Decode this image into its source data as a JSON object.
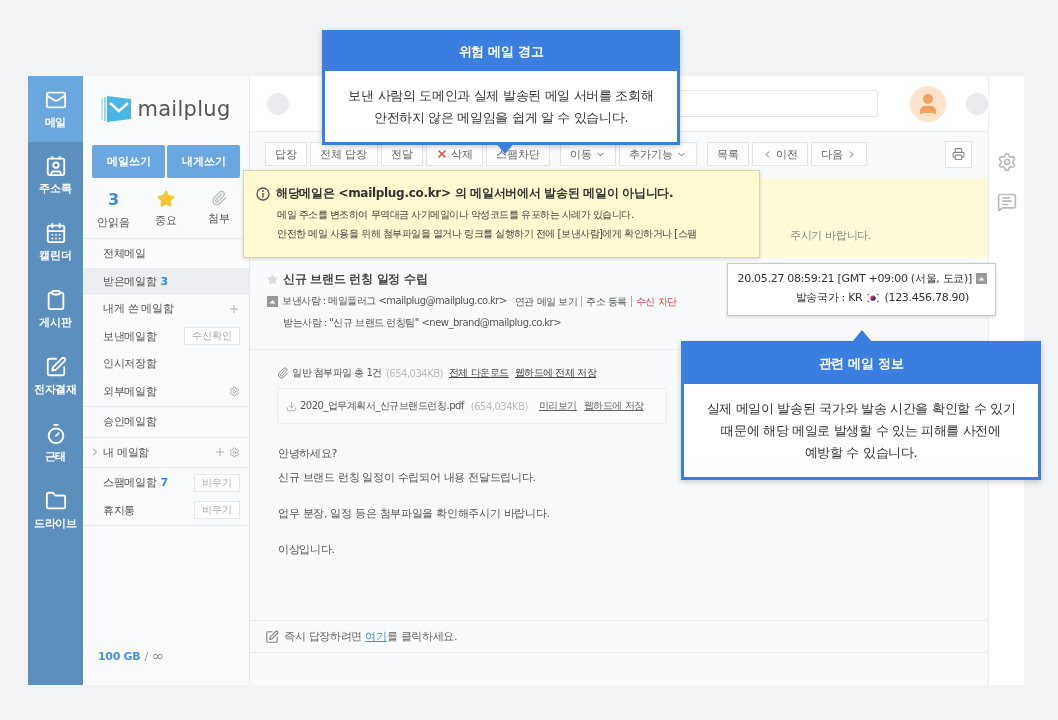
{
  "nav": [
    {
      "label": "메일",
      "selected": true
    },
    {
      "label": "주소록",
      "selected": false
    },
    {
      "label": "캘린더",
      "selected": false
    },
    {
      "label": "게시판",
      "selected": false
    },
    {
      "label": "전자결재",
      "selected": false
    },
    {
      "label": "근태",
      "selected": false
    },
    {
      "label": "드라이브",
      "selected": false
    }
  ],
  "logo": {
    "text": "mailplug"
  },
  "compose_buttons": [
    "메일쓰기",
    "내게쓰기"
  ],
  "quick_filters": [
    {
      "label": "안읽음",
      "count": "3"
    },
    {
      "label": "중요"
    },
    {
      "label": "첨부"
    }
  ],
  "folder_sections": [
    [
      {
        "label": "전체메일",
        "kind": "plain",
        "selected": false
      },
      {
        "label": "받은메일함",
        "count": "3",
        "kind": "plain",
        "selected": true
      },
      {
        "label": "내게 쓴 메일함",
        "kind": "add",
        "selected": false
      },
      {
        "label": "보낸메일함",
        "kind": "button",
        "action": "수신확인",
        "selected": false
      },
      {
        "label": "인시저장함",
        "kind": "plain",
        "selected": false
      },
      {
        "label": "외부메일함",
        "kind": "settings",
        "selected": false
      }
    ],
    [
      {
        "label": "승인메일함",
        "kind": "plain",
        "selected": false
      }
    ],
    [
      {
        "label": "내 메일함",
        "kind": "group",
        "selected": false
      }
    ],
    [
      {
        "label": "스팸메일함",
        "count": "7",
        "kind": "button",
        "action": "비우기",
        "selected": false
      },
      {
        "label": "휴지통",
        "kind": "button",
        "action": "비우기",
        "selected": false
      }
    ]
  ],
  "storage": {
    "used": "100 GB",
    "separator": "/",
    "limit": "∞"
  },
  "toolbar_groups": [
    [
      {
        "label": "답장",
        "kind": "plain"
      },
      {
        "label": "전체 답장",
        "kind": "plain"
      },
      {
        "label": "전달",
        "kind": "plain"
      },
      {
        "label": "삭제",
        "kind": "delete"
      },
      {
        "label": "스팸차단",
        "kind": "plain"
      }
    ],
    [
      {
        "label": "이동",
        "kind": "dropdown"
      },
      {
        "label": "추가기능",
        "kind": "dropdown"
      }
    ],
    [
      {
        "label": "목록",
        "kind": "plain"
      },
      {
        "label": "이전",
        "kind": "prev"
      },
      {
        "label": "다음",
        "kind": "next"
      }
    ]
  ],
  "warning_banner": {
    "text": "주시기 바랍니다."
  },
  "warning_popup": {
    "title": "해당메일은 <mailplug.co.kr> 의 메일서버에서 발송된 메일이 아닙니다.",
    "lines": [
      "메일 주소를 변조하여 무역대금 사기메일이나 악성코드를 유포하는 사례가 있습니다.",
      "안전한 메일 사용을 위해 첨부파일을 열거나 링크를 실행하기 전에 [보낸사람]에게 확인하거나 [스팸"
    ]
  },
  "message": {
    "subject": "신규 브랜드 런칭 일정 수립",
    "starred": false,
    "sender": "보낸사람 : 메일플러그 <mailplug@mailplug.co.kr>",
    "sender_links": [
      {
        "label": "연관 메일 보기",
        "kind": "normal"
      },
      {
        "label": "주소 등록",
        "kind": "normal"
      },
      {
        "label": "수신 차단",
        "kind": "danger"
      }
    ],
    "recipient": "받는사람 : \"신규 브랜드 런칭팀\" <new_brand@mailplug.co.kr>",
    "attachments": {
      "summary": "일반 첨부파일 총 1건",
      "size": "(654,034KB)",
      "actions": [
        "전체 다운로드",
        "웹하드에 전체 저장"
      ],
      "files": [
        {
          "name": "2020_업무계획서_신규브랜드런칭.pdf",
          "size": "(654,034KB)",
          "actions": [
            "미리보기",
            "웹하드에 저장"
          ]
        }
      ]
    },
    "body": [
      [
        "안녕하세요?",
        "신규 브랜드 런칭 일정이 수립되어 내용 전달드립니다."
      ],
      [
        "업무 분장, 일정 등은 첨부파일을 확인해주시기 바랍니다."
      ],
      [
        "이상입니다."
      ]
    ]
  },
  "quick_reply": {
    "before": "즉시 답장하려면 ",
    "link": "여기",
    "after": "를 클릭하세요."
  },
  "send_info": {
    "time": "20.05.27 08:59:21 [GMT +09:00 (서울, 도쿄)]",
    "country": "발송국가 : KR",
    "ip": "(123.456.78.90)"
  },
  "callouts": [
    {
      "title": "위험 메일 경고",
      "text": "보낸 사람의 도메인과 실제 발송된 메일 서버를 조회해\n안전하지 않은 메일임을 쉽게 알 수 있습니다."
    },
    {
      "title": "관련 메일 정보",
      "text": "실제 메일이 발송된 국가와 발송 시간을 확인할 수 있기\n때문에 해당 메일로 발생할 수 있는 피해를 사전에\n예방할 수 있습니다."
    }
  ]
}
